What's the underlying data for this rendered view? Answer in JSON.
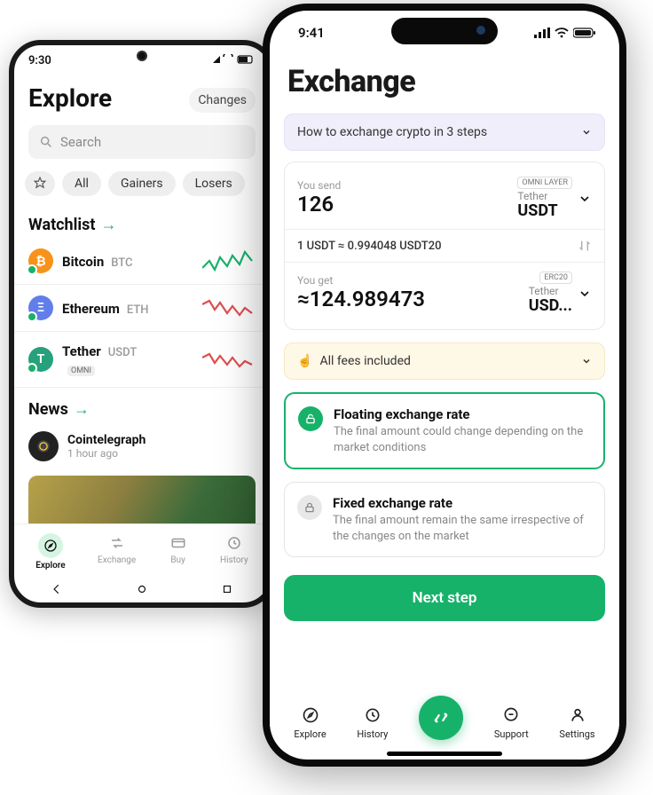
{
  "left_phone": {
    "time": "9:30",
    "title": "Explore",
    "changes_label": "Changes",
    "search_placeholder": "Search",
    "pills": {
      "all": "All",
      "gainers": "Gainers",
      "losers": "Losers"
    },
    "watchlist_title": "Watchlist",
    "coins": [
      {
        "name": "Bitcoin",
        "sym": "BTC",
        "color": "#f7931a",
        "letter": "₿",
        "spark_color": "#17b26a"
      },
      {
        "name": "Ethereum",
        "sym": "ETH",
        "color": "#627eea",
        "letter": "Ξ",
        "spark_color": "#e04f4f"
      },
      {
        "name": "Tether",
        "sym": "USDT",
        "color": "#26a17b",
        "letter": "T",
        "spark_color": "#e04f4f",
        "badge": "OMNI"
      }
    ],
    "news_title": "News",
    "news": {
      "source": "Cointelegraph",
      "time": "1 hour ago"
    },
    "tabs": [
      "Explore",
      "Exchange",
      "Buy",
      "History"
    ]
  },
  "right_phone": {
    "time": "9:41",
    "title": "Exchange",
    "howto_text": "How to exchange crypto in 3 steps",
    "send": {
      "label": "You send",
      "value": "126",
      "network": "OMNI LAYER",
      "token_name": "Tether",
      "token_sym": "USDT"
    },
    "rate_text": "1 USDT ≈ 0.994048 USDT20",
    "get": {
      "label": "You get",
      "value": "≈124.989473",
      "network": "ERC20",
      "token_name": "Tether",
      "token_sym": "USD..."
    },
    "fees_text": "All fees included",
    "rate_options": {
      "floating": {
        "title": "Floating exchange rate",
        "desc": "The final amount could change depending on the market conditions"
      },
      "fixed": {
        "title": "Fixed exchange rate",
        "desc": "The final amount remain the same irrespective of the changes on the market"
      }
    },
    "next_label": "Next step",
    "tabs": [
      "Explore",
      "History",
      "Support",
      "Settings"
    ]
  }
}
